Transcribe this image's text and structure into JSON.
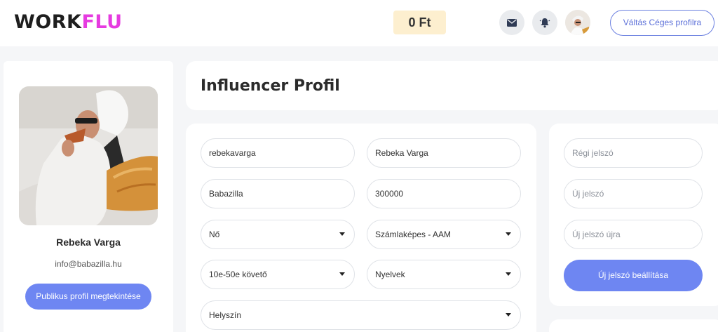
{
  "header": {
    "logo_part1": "WORK",
    "logo_part2": "FLU",
    "balance": "0 Ft",
    "icons": [
      "envelope-icon",
      "bell-icon"
    ],
    "switch_button": "Váltás Céges profilra"
  },
  "profile": {
    "name": "Rebeka Varga",
    "email": "info@babazilla.hu",
    "public_button": "Publikus profil megtekintése"
  },
  "main": {
    "title": "Influencer Profil"
  },
  "form": {
    "username": "rebekavarga",
    "full_name": "Rebeka Varga",
    "company": "Babazilla",
    "amount": "300000",
    "gender": "Nő",
    "invoice": "Számlaképes - AAM",
    "followers": "10e-50e követő",
    "languages": "Nyelvek",
    "location": "Helyszín"
  },
  "password": {
    "old_placeholder": "Régi jelszó",
    "new_placeholder": "Új jelszó",
    "repeat_placeholder": "Új jelszó újra",
    "submit": "Új jelszó beállítása"
  },
  "colors": {
    "accent": "#6e86f2",
    "logo_pink": "#e63be0",
    "balance_bg": "#fdefcf"
  }
}
